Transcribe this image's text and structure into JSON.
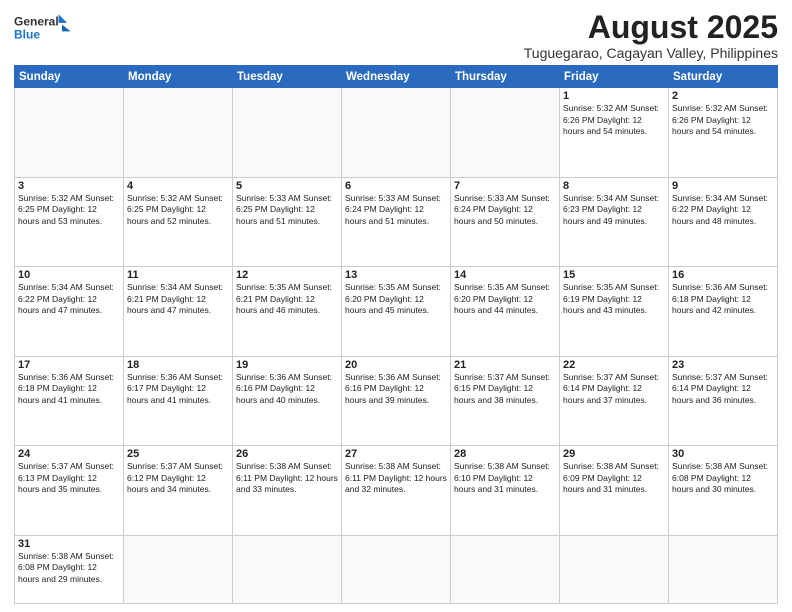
{
  "logo": {
    "line1": "General",
    "line2": "Blue"
  },
  "title": "August 2025",
  "subtitle": "Tuguegarao, Cagayan Valley, Philippines",
  "days_of_week": [
    "Sunday",
    "Monday",
    "Tuesday",
    "Wednesday",
    "Thursday",
    "Friday",
    "Saturday"
  ],
  "weeks": [
    [
      {
        "date": "",
        "info": ""
      },
      {
        "date": "",
        "info": ""
      },
      {
        "date": "",
        "info": ""
      },
      {
        "date": "",
        "info": ""
      },
      {
        "date": "",
        "info": ""
      },
      {
        "date": "1",
        "info": "Sunrise: 5:32 AM\nSunset: 6:26 PM\nDaylight: 12 hours\nand 54 minutes."
      },
      {
        "date": "2",
        "info": "Sunrise: 5:32 AM\nSunset: 6:26 PM\nDaylight: 12 hours\nand 54 minutes."
      }
    ],
    [
      {
        "date": "3",
        "info": "Sunrise: 5:32 AM\nSunset: 6:25 PM\nDaylight: 12 hours\nand 53 minutes."
      },
      {
        "date": "4",
        "info": "Sunrise: 5:32 AM\nSunset: 6:25 PM\nDaylight: 12 hours\nand 52 minutes."
      },
      {
        "date": "5",
        "info": "Sunrise: 5:33 AM\nSunset: 6:25 PM\nDaylight: 12 hours\nand 51 minutes."
      },
      {
        "date": "6",
        "info": "Sunrise: 5:33 AM\nSunset: 6:24 PM\nDaylight: 12 hours\nand 51 minutes."
      },
      {
        "date": "7",
        "info": "Sunrise: 5:33 AM\nSunset: 6:24 PM\nDaylight: 12 hours\nand 50 minutes."
      },
      {
        "date": "8",
        "info": "Sunrise: 5:34 AM\nSunset: 6:23 PM\nDaylight: 12 hours\nand 49 minutes."
      },
      {
        "date": "9",
        "info": "Sunrise: 5:34 AM\nSunset: 6:22 PM\nDaylight: 12 hours\nand 48 minutes."
      }
    ],
    [
      {
        "date": "10",
        "info": "Sunrise: 5:34 AM\nSunset: 6:22 PM\nDaylight: 12 hours\nand 47 minutes."
      },
      {
        "date": "11",
        "info": "Sunrise: 5:34 AM\nSunset: 6:21 PM\nDaylight: 12 hours\nand 47 minutes."
      },
      {
        "date": "12",
        "info": "Sunrise: 5:35 AM\nSunset: 6:21 PM\nDaylight: 12 hours\nand 46 minutes."
      },
      {
        "date": "13",
        "info": "Sunrise: 5:35 AM\nSunset: 6:20 PM\nDaylight: 12 hours\nand 45 minutes."
      },
      {
        "date": "14",
        "info": "Sunrise: 5:35 AM\nSunset: 6:20 PM\nDaylight: 12 hours\nand 44 minutes."
      },
      {
        "date": "15",
        "info": "Sunrise: 5:35 AM\nSunset: 6:19 PM\nDaylight: 12 hours\nand 43 minutes."
      },
      {
        "date": "16",
        "info": "Sunrise: 5:36 AM\nSunset: 6:18 PM\nDaylight: 12 hours\nand 42 minutes."
      }
    ],
    [
      {
        "date": "17",
        "info": "Sunrise: 5:36 AM\nSunset: 6:18 PM\nDaylight: 12 hours\nand 41 minutes."
      },
      {
        "date": "18",
        "info": "Sunrise: 5:36 AM\nSunset: 6:17 PM\nDaylight: 12 hours\nand 41 minutes."
      },
      {
        "date": "19",
        "info": "Sunrise: 5:36 AM\nSunset: 6:16 PM\nDaylight: 12 hours\nand 40 minutes."
      },
      {
        "date": "20",
        "info": "Sunrise: 5:36 AM\nSunset: 6:16 PM\nDaylight: 12 hours\nand 39 minutes."
      },
      {
        "date": "21",
        "info": "Sunrise: 5:37 AM\nSunset: 6:15 PM\nDaylight: 12 hours\nand 38 minutes."
      },
      {
        "date": "22",
        "info": "Sunrise: 5:37 AM\nSunset: 6:14 PM\nDaylight: 12 hours\nand 37 minutes."
      },
      {
        "date": "23",
        "info": "Sunrise: 5:37 AM\nSunset: 6:14 PM\nDaylight: 12 hours\nand 36 minutes."
      }
    ],
    [
      {
        "date": "24",
        "info": "Sunrise: 5:37 AM\nSunset: 6:13 PM\nDaylight: 12 hours\nand 35 minutes."
      },
      {
        "date": "25",
        "info": "Sunrise: 5:37 AM\nSunset: 6:12 PM\nDaylight: 12 hours\nand 34 minutes."
      },
      {
        "date": "26",
        "info": "Sunrise: 5:38 AM\nSunset: 6:11 PM\nDaylight: 12 hours\nand 33 minutes."
      },
      {
        "date": "27",
        "info": "Sunrise: 5:38 AM\nSunset: 6:11 PM\nDaylight: 12 hours\nand 32 minutes."
      },
      {
        "date": "28",
        "info": "Sunrise: 5:38 AM\nSunset: 6:10 PM\nDaylight: 12 hours\nand 31 minutes."
      },
      {
        "date": "29",
        "info": "Sunrise: 5:38 AM\nSunset: 6:09 PM\nDaylight: 12 hours\nand 31 minutes."
      },
      {
        "date": "30",
        "info": "Sunrise: 5:38 AM\nSunset: 6:08 PM\nDaylight: 12 hours\nand 30 minutes."
      }
    ],
    [
      {
        "date": "31",
        "info": "Sunrise: 5:38 AM\nSunset: 6:08 PM\nDaylight: 12 hours\nand 29 minutes."
      },
      {
        "date": "",
        "info": ""
      },
      {
        "date": "",
        "info": ""
      },
      {
        "date": "",
        "info": ""
      },
      {
        "date": "",
        "info": ""
      },
      {
        "date": "",
        "info": ""
      },
      {
        "date": "",
        "info": ""
      }
    ]
  ]
}
